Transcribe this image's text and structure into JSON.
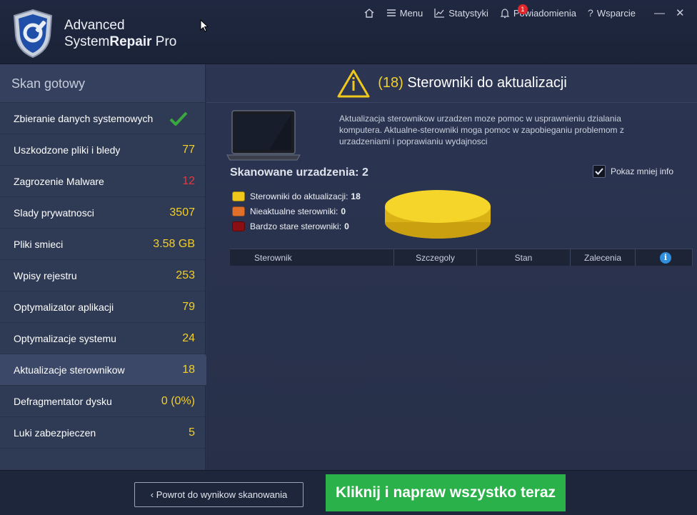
{
  "app": {
    "name_line1": "Advanced",
    "name_line2_a": "System",
    "name_line2_b": "Repair",
    "name_line2_c": " Pro"
  },
  "nav": {
    "menu": "Menu",
    "stats": "Statystyki",
    "notifications": "Powiadomienia",
    "notif_count": "1",
    "support": "Wsparcie",
    "minimize": "—",
    "close": "✕"
  },
  "sidebar": {
    "title": "Skan gotowy",
    "items": [
      {
        "label": "Zbieranie danych systemowych",
        "value": ""
      },
      {
        "label": "Uszkodzone pliki i bledy",
        "value": "77"
      },
      {
        "label": "Zagrozenie Malware",
        "value": "12"
      },
      {
        "label": "Slady prywatnosci",
        "value": "3507"
      },
      {
        "label": "Pliki smieci",
        "value": "3.58 GB"
      },
      {
        "label": "Wpisy rejestru",
        "value": "253"
      },
      {
        "label": "Optymalizator aplikacji",
        "value": "79"
      },
      {
        "label": "Optymalizacje systemu",
        "value": "24"
      },
      {
        "label": "Aktualizacje sterownikow",
        "value": "18"
      },
      {
        "label": "Defragmentator dysku",
        "value": "0 (0%)"
      },
      {
        "label": "Luki zabezpieczen",
        "value": "5"
      }
    ]
  },
  "main": {
    "title_count": "(18)",
    "title_text": " Sterowniki do aktualizacji",
    "description": "Aktualizacja sterownikow urzadzen moze pomoc w usprawnieniu dzialania komputera. Aktualne-sterowniki moga pomoc w zapobieganiu problemom z urzadzeniami i poprawianiu wydajnosci",
    "scanned": "Skanowane urzadzenia: 2",
    "show_less": "Pokaz mniej info",
    "legend": [
      {
        "label": "Sterowniki do aktualizacji:",
        "value": "18",
        "color": "#f0c81c"
      },
      {
        "label": "Nieaktualne sterowniki:",
        "value": "0",
        "color": "#e0702a"
      },
      {
        "label": "Bardzo stare sterowniki:",
        "value": "0",
        "color": "#8a0f12"
      }
    ],
    "table_headers": [
      "Sterownik",
      "Szczegoly",
      "Stan",
      "Zalecenia"
    ]
  },
  "footer": {
    "back": "Powrot do wynikow skanowania",
    "fix": "Kliknij i napraw wszystko teraz"
  },
  "colors": {
    "accent_yellow": "#f3d028",
    "danger_red": "#e8383a",
    "fix_green": "#2bb14a"
  }
}
